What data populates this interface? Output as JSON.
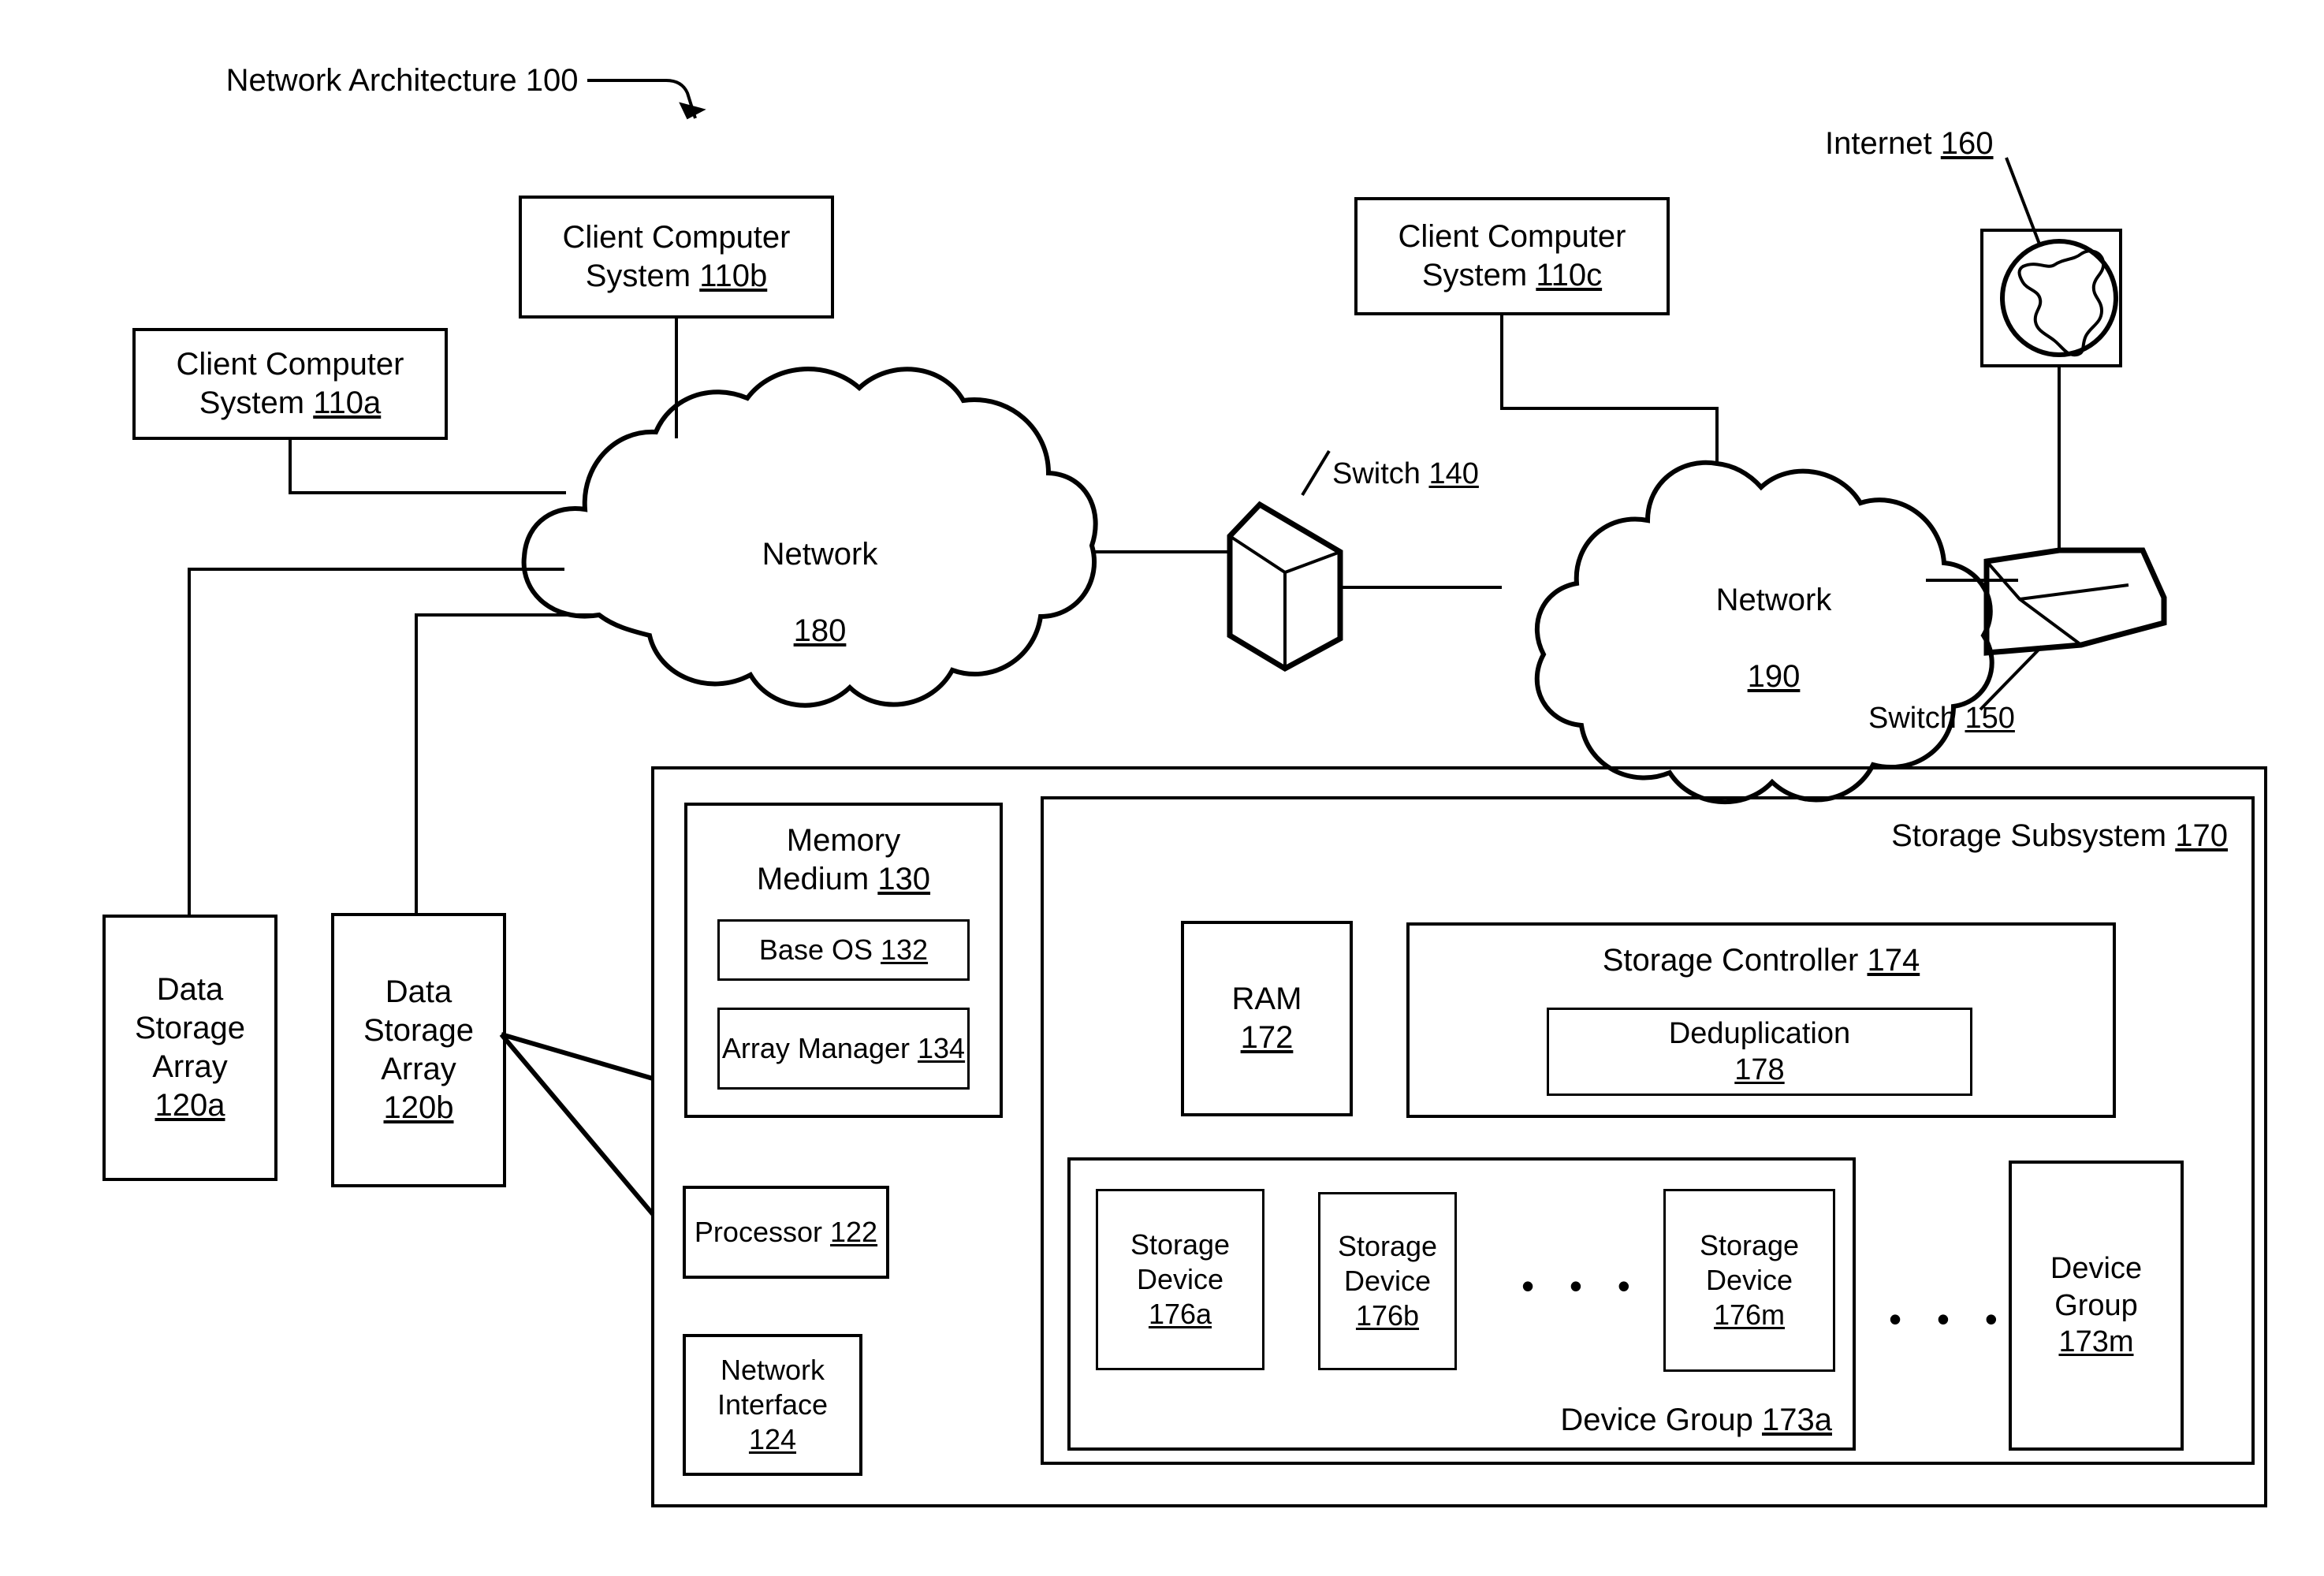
{
  "figure": {
    "title": "Network Architecture 100",
    "type": "patent-block-diagram"
  },
  "annotations": {
    "architecture_callout": "Network Architecture 100",
    "internet_callout": "Internet 160",
    "switch_140_callout": "Switch 140",
    "switch_150_callout": "Switch 150"
  },
  "clients": [
    {
      "id": "110a",
      "line1": "Client Computer",
      "line2": "System",
      "ref": "110a"
    },
    {
      "id": "110b",
      "line1": "Client Computer",
      "line2": "System",
      "ref": "110b"
    },
    {
      "id": "110c",
      "line1": "Client Computer",
      "line2": "System",
      "ref": "110c"
    }
  ],
  "networks": [
    {
      "id": "180",
      "label": "Network",
      "ref": "180"
    },
    {
      "id": "190",
      "label": "Network",
      "ref": "190"
    }
  ],
  "switches": [
    {
      "id": "140",
      "label": "Switch",
      "ref": "140"
    },
    {
      "id": "150",
      "label": "Switch",
      "ref": "150"
    }
  ],
  "internet": {
    "label": "Internet",
    "ref": "160",
    "icon": "globe-icon"
  },
  "storage_arrays": [
    {
      "id": "120a",
      "line1": "Data",
      "line2": "Storage",
      "line3": "Array",
      "ref": "120a"
    },
    {
      "id": "120b",
      "line1": "Data",
      "line2": "Storage",
      "line3": "Array",
      "ref": "120b"
    }
  ],
  "array_detail": {
    "memory_medium": {
      "line1": "Memory",
      "line2": "Medium",
      "ref": "130",
      "children": [
        {
          "label": "Base OS",
          "ref": "132"
        },
        {
          "label": "Array Manager",
          "ref": "134"
        }
      ]
    },
    "processor": {
      "label": "Processor",
      "ref": "122"
    },
    "network_interface": {
      "line1": "Network",
      "line2": "Interface",
      "ref": "124"
    }
  },
  "storage_subsystem": {
    "label": "Storage Subsystem",
    "ref": "170",
    "ram": {
      "label": "RAM",
      "ref": "172"
    },
    "storage_controller": {
      "label": "Storage Controller",
      "ref": "174",
      "deduplication": {
        "label": "Deduplication",
        "ref": "178"
      }
    },
    "device_group_a": {
      "label": "Device Group",
      "ref": "173a",
      "devices": [
        {
          "line1": "Storage",
          "line2": "Device",
          "ref": "176a"
        },
        {
          "line1": "Storage",
          "line2": "Device",
          "ref": "176b"
        },
        {
          "line1": "Storage",
          "line2": "Device",
          "ref": "176m"
        }
      ],
      "ellipsis": "• • •"
    },
    "device_group_m": {
      "line1": "Device",
      "line2": "Group",
      "ref": "173m"
    },
    "group_ellipsis": "• • •"
  },
  "colors": {
    "ink": "#000000",
    "paper": "#ffffff"
  }
}
